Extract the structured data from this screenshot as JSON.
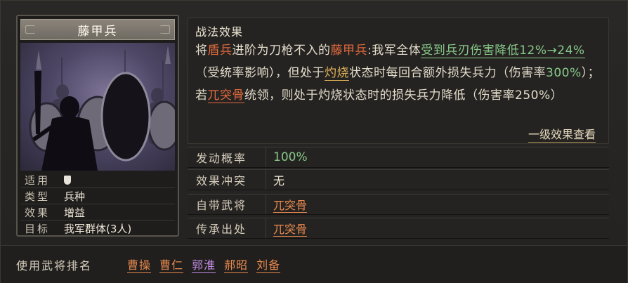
{
  "card": {
    "title": "藤甲兵",
    "rows": [
      {
        "key": "适用",
        "value": "",
        "icon": "shield-icon"
      },
      {
        "key": "类型",
        "value": "兵种"
      },
      {
        "key": "效果",
        "value": "增益"
      },
      {
        "key": "目标",
        "value": "我军群体(3人)"
      }
    ]
  },
  "tactic": {
    "section_title": "战法效果",
    "segments": [
      {
        "t": "将",
        "c": ""
      },
      {
        "t": "盾兵",
        "c": "red"
      },
      {
        "t": "进阶为刀枪不入的",
        "c": ""
      },
      {
        "t": "藤甲兵",
        "c": "red"
      },
      {
        "t": ":我军全体",
        "c": ""
      },
      {
        "t": "受到兵刃伤害降低12%→24%",
        "c": "grnu"
      },
      {
        "t": "（受统率影响），但处于",
        "c": ""
      },
      {
        "t": "灼烧",
        "c": "ylwu"
      },
      {
        "t": "状态时每回合额外损失兵力（伤害率",
        "c": ""
      },
      {
        "t": "300%",
        "c": "grn"
      },
      {
        "t": "）；若",
        "c": ""
      },
      {
        "t": "兀突骨",
        "c": "redu"
      },
      {
        "t": "统领，则处于灼烧状态时的损失兵力降低（伤害率250%）",
        "c": ""
      }
    ],
    "more_link": "一级效果查看"
  },
  "info": [
    {
      "key": "发动概率",
      "value": "100%",
      "style": "grn"
    },
    {
      "key": "效果冲突",
      "value": "无",
      "style": ""
    },
    {
      "key": "自带武将",
      "value": "兀突骨",
      "style": "link"
    },
    {
      "key": "传承出处",
      "value": "兀突骨",
      "style": "link"
    }
  ],
  "users": {
    "label": "使用武将排名",
    "generals": [
      {
        "name": "曹操",
        "tone": "o"
      },
      {
        "name": "曹仁",
        "tone": "o"
      },
      {
        "name": "郭淮",
        "tone": "p"
      },
      {
        "name": "郝昭",
        "tone": "o"
      },
      {
        "name": "刘备",
        "tone": "o"
      }
    ]
  },
  "colors": {
    "accent_red": "#e06a3e",
    "accent_green": "#88c98a",
    "accent_purple": "#c48ee6",
    "accent_orange": "#e8894f"
  }
}
